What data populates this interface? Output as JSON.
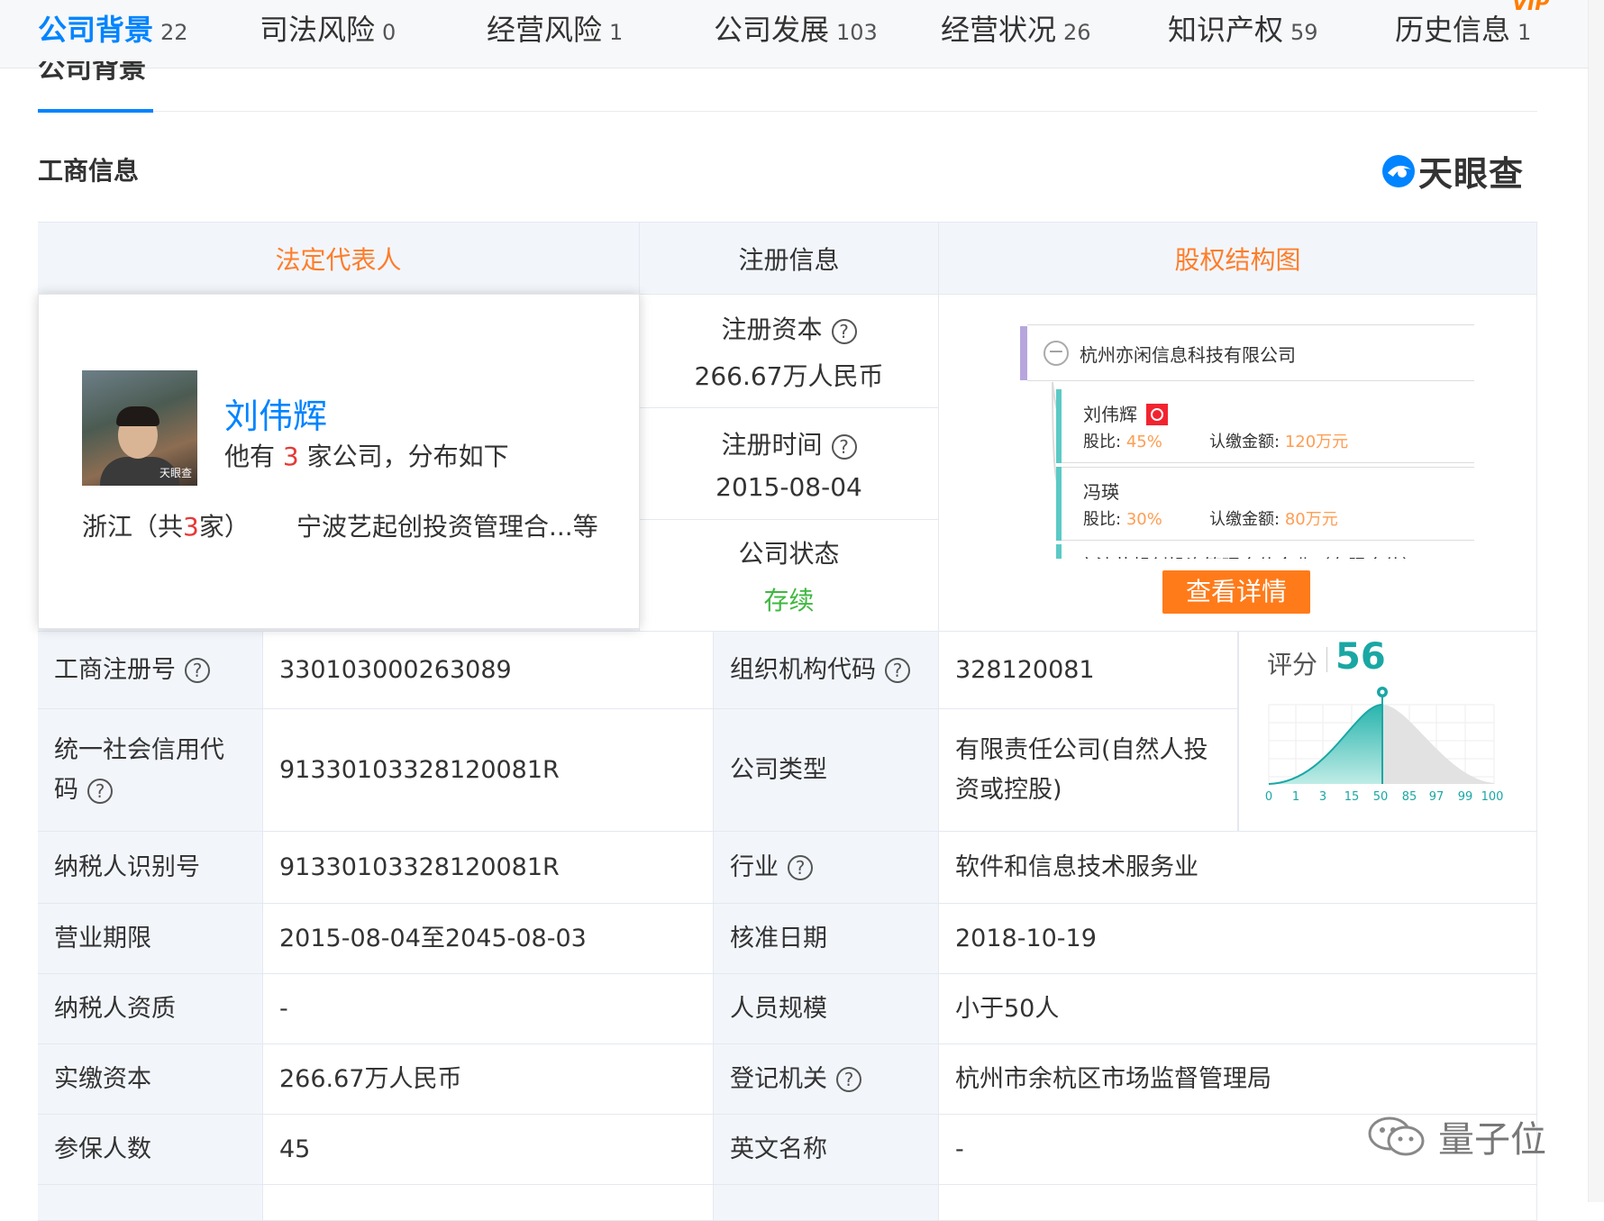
{
  "tabs": [
    {
      "label": "公司背景",
      "count": "22",
      "active": true
    },
    {
      "label": "司法风险",
      "count": "0"
    },
    {
      "label": "经营风险",
      "count": "1"
    },
    {
      "label": "公司发展",
      "count": "103"
    },
    {
      "label": "经营状况",
      "count": "26"
    },
    {
      "label": "知识产权",
      "count": "59"
    },
    {
      "label": "历史信息",
      "count": "1"
    }
  ],
  "vip_badge": "VIP",
  "section_title": "公司背景",
  "subsection_title": "工商信息",
  "brand": {
    "name": "天眼查",
    "color": "#0084ff"
  },
  "headers": {
    "legal_rep": "法定代表人",
    "registration": "注册信息",
    "equity": "股权结构图"
  },
  "legal_rep": {
    "name": "刘伟辉",
    "desc_prefix": "他有",
    "company_count": "3",
    "desc_suffix": "家公司，分布如下",
    "region_prefix": "浙江（共",
    "region_count": "3",
    "region_suffix": "家）",
    "company": "宁波艺起创投资管理合...等",
    "avatar_watermark": "天眼查"
  },
  "registration": {
    "capital_label": "注册资本",
    "capital_value": "266.67万人民币",
    "date_label": "注册时间",
    "date_value": "2015-08-04",
    "status_label": "公司状态",
    "status_value": "存续"
  },
  "equity": {
    "root": "杭州亦闲信息科技有限公司",
    "shareholders": [
      {
        "name": "刘伟辉",
        "ratio_label": "股比:",
        "ratio": "45%",
        "amount_label": "认缴金额:",
        "amount": "120万元",
        "badge": true
      },
      {
        "name": "冯瑛",
        "ratio_label": "股比:",
        "ratio": "30%",
        "amount_label": "认缴金额:",
        "amount": "80万元",
        "badge": false
      }
    ],
    "cut_text": "宁波艺起创投资管理合伙企业（有限合伙）",
    "detail_button": "查看详情"
  },
  "score": {
    "label": "评分",
    "value": "56",
    "ticks": [
      "0",
      "1",
      "3",
      "15",
      "50",
      "85",
      "97",
      "99",
      "100"
    ],
    "accent": "#1aa7a4"
  },
  "rows": [
    {
      "l1": "工商注册号",
      "h1": true,
      "v1": "330103000263089",
      "l2": "组织机构代码",
      "h2": true,
      "v2": "328120081"
    },
    {
      "l1": "统一社会信用代码",
      "h1": true,
      "v1": "91330103328120081R",
      "l2": "公司类型",
      "h2": false,
      "v2": "有限责任公司(自然人投资或控股)"
    },
    {
      "l1": "纳税人识别号",
      "h1": false,
      "v1": "91330103328120081R",
      "l2": "行业",
      "h2": true,
      "v2": "软件和信息技术服务业"
    },
    {
      "l1": "营业期限",
      "h1": false,
      "v1": "2015-08-04至2045-08-03",
      "l2": "核准日期",
      "h2": false,
      "v2": "2018-10-19"
    },
    {
      "l1": "纳税人资质",
      "h1": false,
      "v1": "-",
      "l2": "人员规模",
      "h2": false,
      "v2": "小于50人"
    },
    {
      "l1": "实缴资本",
      "h1": false,
      "v1": "266.67万人民币",
      "l2": "登记机关",
      "h2": true,
      "v2": "杭州市余杭区市场监督管理局"
    },
    {
      "l1": "参保人数",
      "h1": false,
      "v1": "45",
      "l2": "英文名称",
      "h2": false,
      "v2": "-"
    }
  ],
  "help_glyph": "?",
  "watermark": "量子位"
}
